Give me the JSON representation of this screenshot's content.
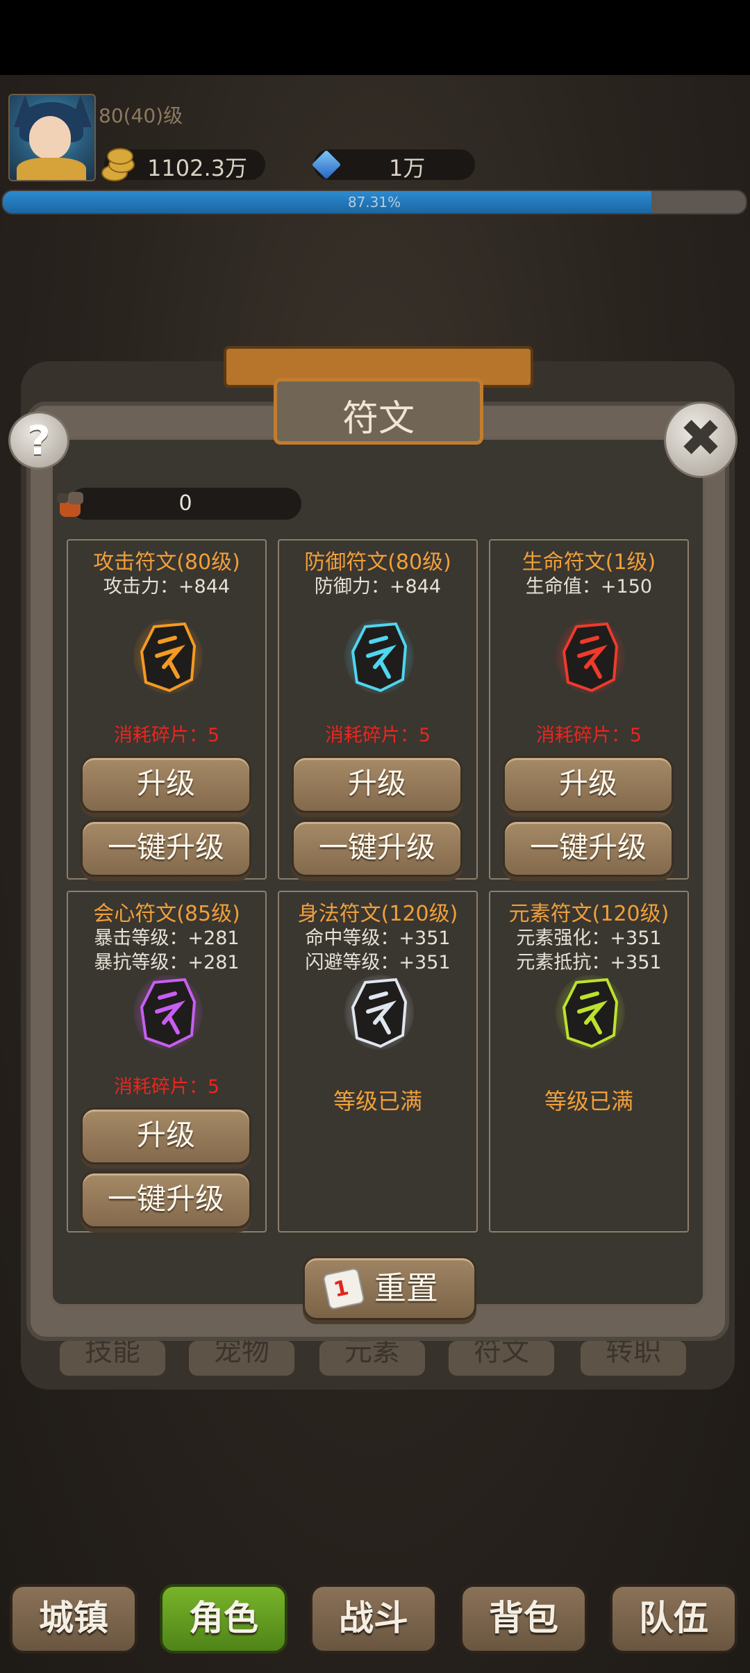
{
  "header": {
    "level": "80(40)级",
    "gold": "1102.3万",
    "gems": "1万",
    "exp_percent": 87.31,
    "exp_label": "87.31%"
  },
  "panel": {
    "title": "符文",
    "help_label": "?",
    "close_label": "✖",
    "fragments": "0"
  },
  "runes": [
    {
      "title": "攻击符文(80级)",
      "stats": [
        "攻击力：+844"
      ],
      "cost": "消耗碎片：5",
      "upgrade": "升级",
      "upgrade_all": "一键升级",
      "color": "#f59a22",
      "icon": "attack-rune-icon"
    },
    {
      "title": "防御符文(80级)",
      "stats": [
        "防御力：+844"
      ],
      "cost": "消耗碎片：5",
      "upgrade": "升级",
      "upgrade_all": "一键升级",
      "color": "#4fd6f0",
      "icon": "defense-rune-icon"
    },
    {
      "title": "生命符文(1级)",
      "stats": [
        "生命值：+150"
      ],
      "cost": "消耗碎片：5",
      "upgrade": "升级",
      "upgrade_all": "一键升级",
      "color": "#ef3a2c",
      "icon": "life-rune-icon"
    },
    {
      "title": "会心符文(85级)",
      "stats": [
        "暴击等级：+281",
        "暴抗等级：+281"
      ],
      "cost": "消耗碎片：5",
      "upgrade": "升级",
      "upgrade_all": "一键升级",
      "color": "#c85ef2",
      "icon": "crit-rune-icon"
    },
    {
      "title": "身法符文(120级)",
      "stats": [
        "命中等级：+351",
        "闪避等级：+351"
      ],
      "maxed": "等级已满",
      "color": "#dfe6ee",
      "icon": "agility-rune-icon"
    },
    {
      "title": "元素符文(120级)",
      "stats": [
        "元素强化：+351",
        "元素抵抗：+351"
      ],
      "maxed": "等级已满",
      "color": "#bde22e",
      "icon": "element-rune-icon"
    }
  ],
  "reset": {
    "label": "重置",
    "dice": "1"
  },
  "sub_tabs": [
    "技能",
    "宠物",
    "元素",
    "符文",
    "转职"
  ],
  "nav": [
    {
      "label": "城镇",
      "active": false
    },
    {
      "label": "角色",
      "active": true
    },
    {
      "label": "战斗",
      "active": false
    },
    {
      "label": "背包",
      "active": false
    },
    {
      "label": "队伍",
      "active": false
    }
  ]
}
